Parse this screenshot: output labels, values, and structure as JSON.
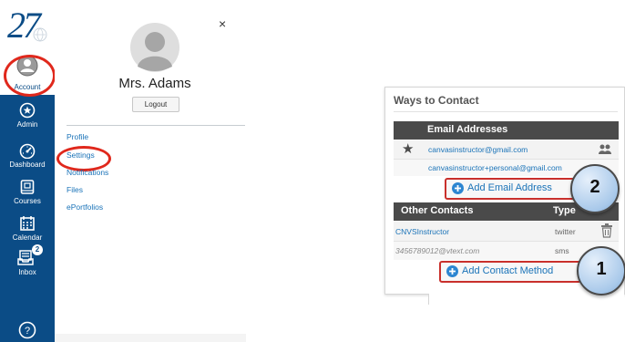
{
  "global_nav": {
    "logo_text": "27",
    "items": [
      {
        "label": "Account"
      },
      {
        "label": "Admin"
      },
      {
        "label": "Dashboard"
      },
      {
        "label": "Courses"
      },
      {
        "label": "Calendar"
      },
      {
        "label": "Inbox",
        "badge": "2"
      }
    ],
    "help_icon": "question-circle-icon"
  },
  "account_tray": {
    "user_name": "Mrs. Adams",
    "logout_label": "Logout",
    "close_label": "×",
    "links": [
      "Profile",
      "Settings",
      "Notifications",
      "Files",
      "ePortfolios"
    ]
  },
  "ways_to_contact": {
    "title": "Ways to Contact",
    "email_header": "Email Addresses",
    "emails": [
      "canvasinstructor@gmail.com",
      "canvasinstructor+personal@gmail.com"
    ],
    "add_email_label": "Add Email Address",
    "other_header": "Other Contacts",
    "type_header": "Type",
    "contacts": [
      {
        "value": "CNVSInstructor",
        "type": "twitter"
      },
      {
        "value": "3456789012@vtext.com",
        "type": "sms"
      }
    ],
    "add_contact_label": "Add Contact Method"
  },
  "callouts": [
    "1",
    "2"
  ],
  "colors": {
    "nav_blue": "#0b4c86",
    "link_blue": "#1a73b8",
    "highlight_red": "#e0281c",
    "header_dark": "#4a4a4a"
  }
}
